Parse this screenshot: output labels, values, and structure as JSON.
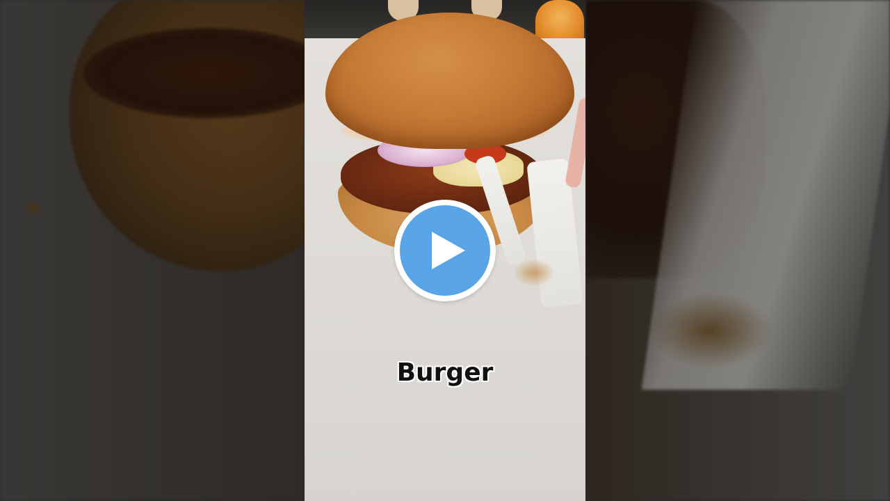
{
  "video": {
    "caption": "Burger"
  },
  "play_button": {
    "icon": "play-icon",
    "accent_color": "#59a4e6"
  }
}
